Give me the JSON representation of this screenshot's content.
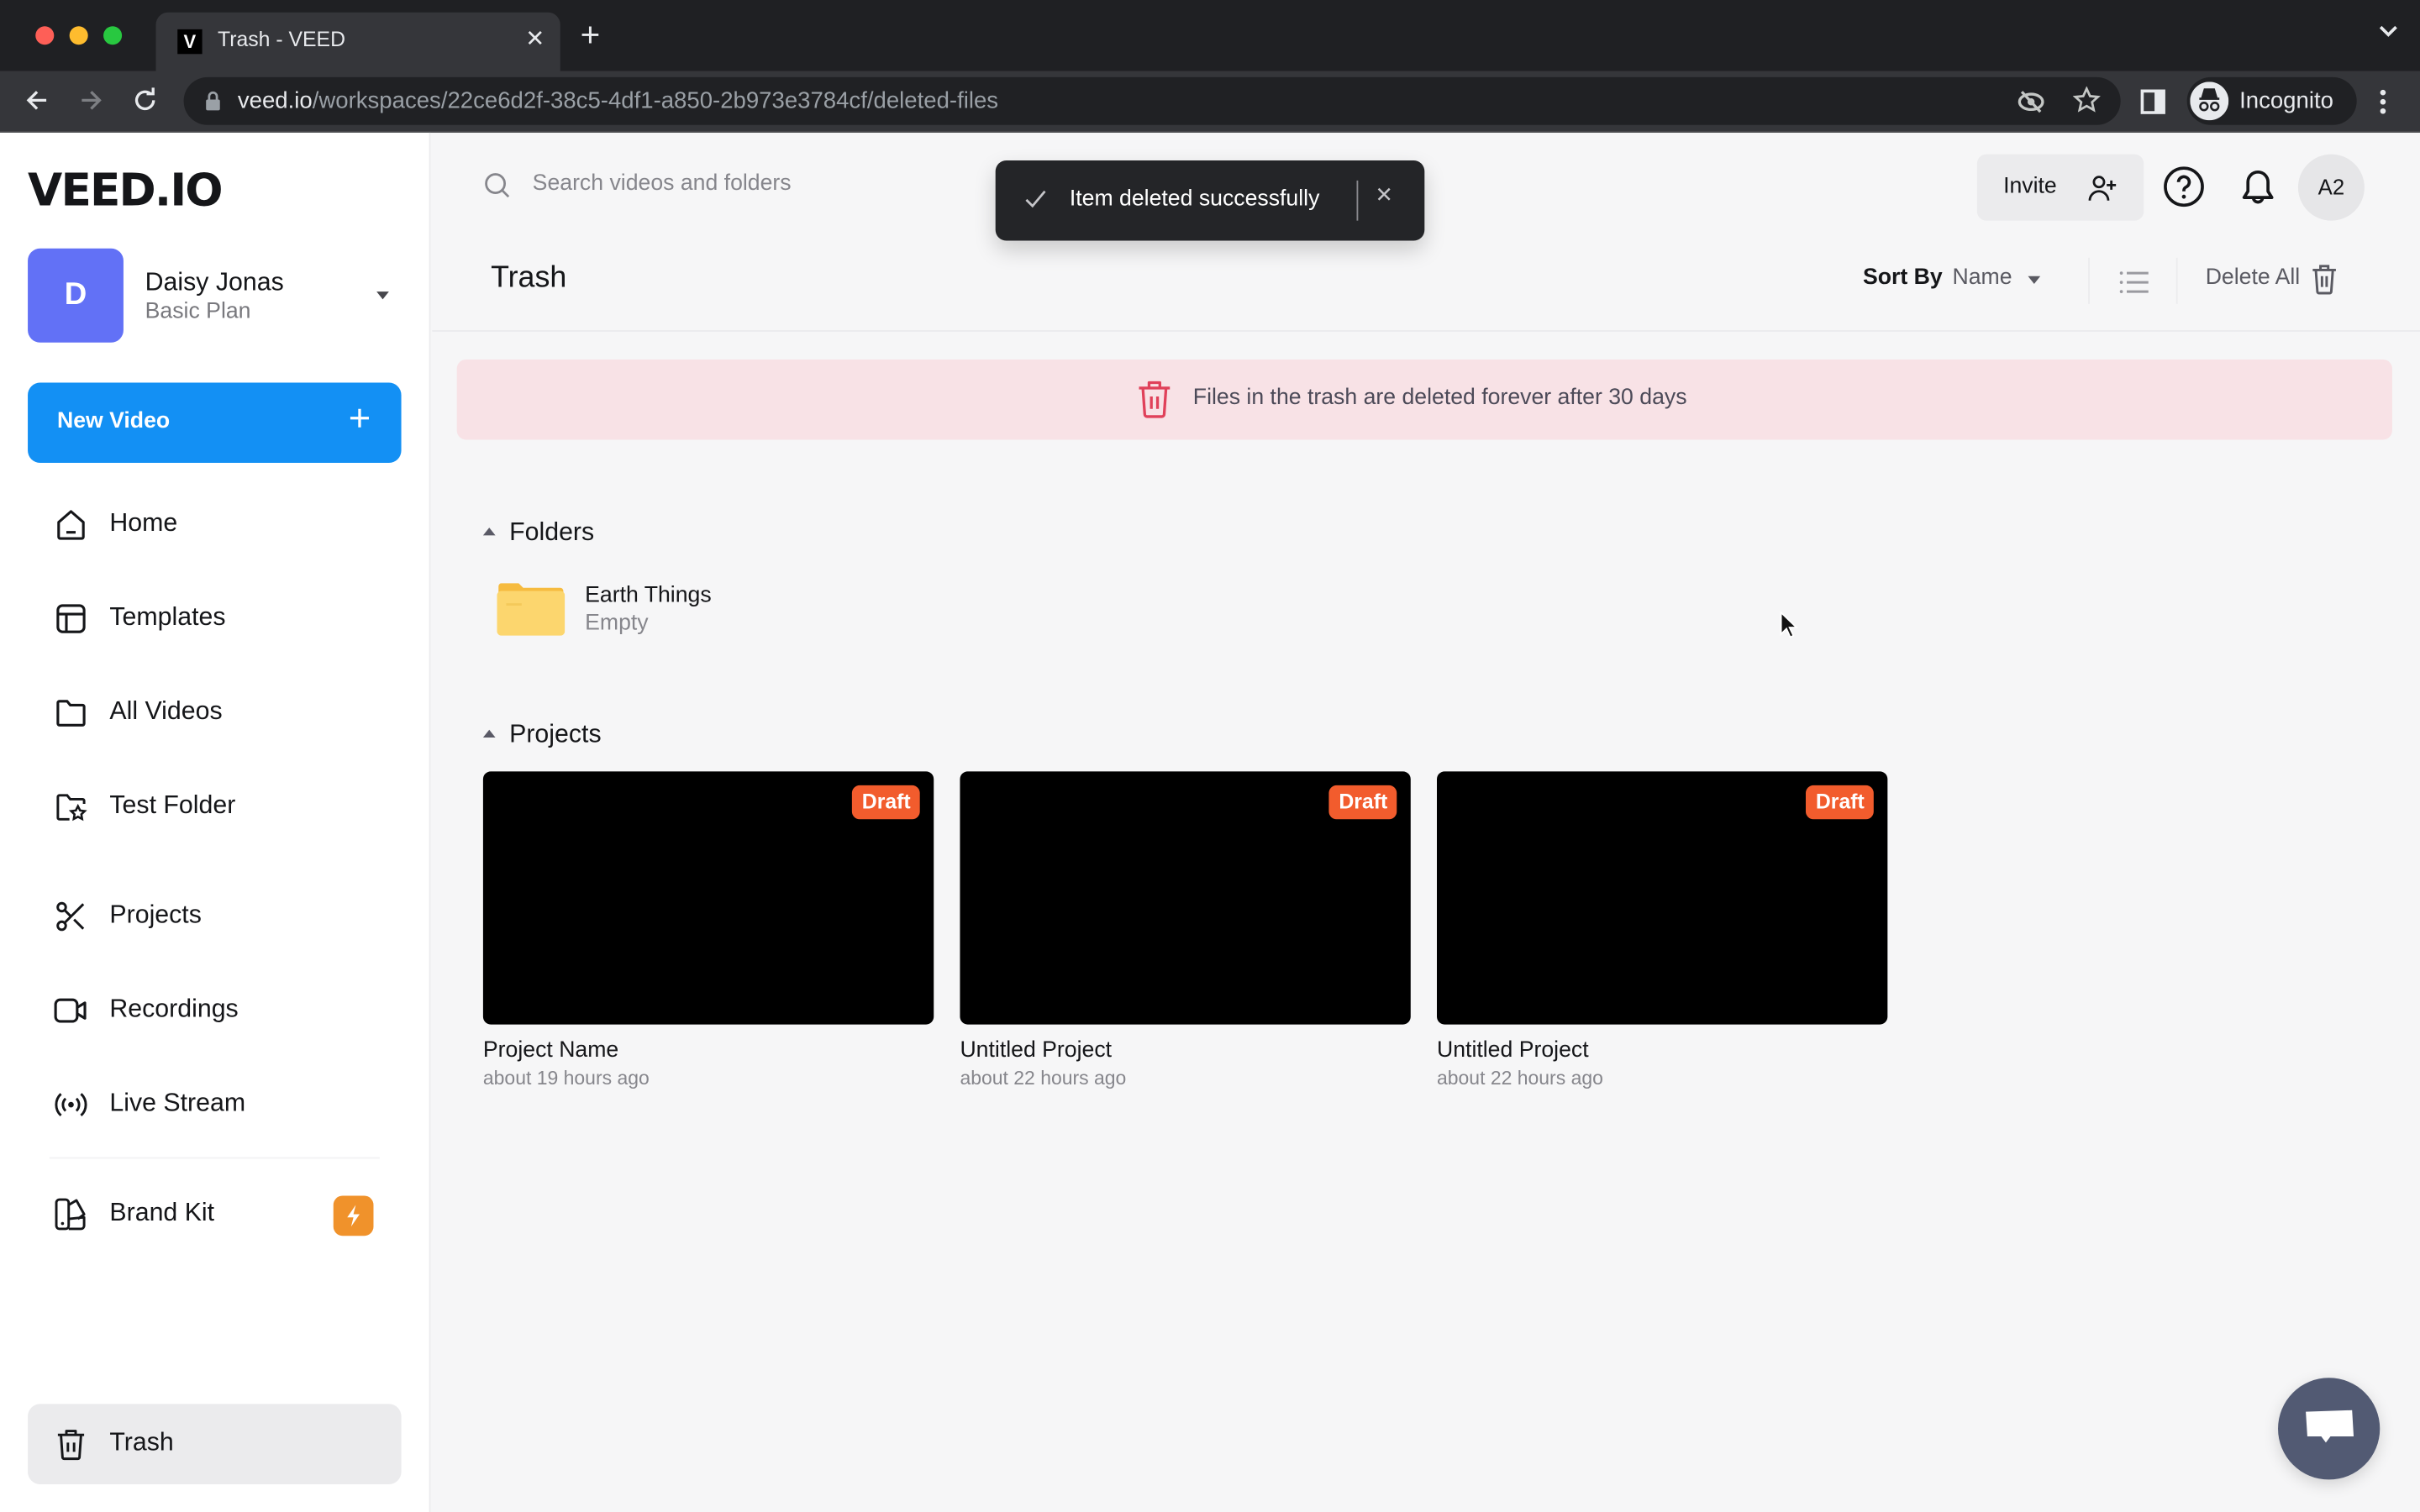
{
  "browser": {
    "tab_title": "Trash - VEED",
    "tab_favicon": "V",
    "url_host": "veed.io",
    "url_path": "/workspaces/22ce6d2f-38c5-4df1-a850-2b973e3784cf/deleted-files",
    "profile_label": "Incognito"
  },
  "sidebar": {
    "logo": "VEED.IO",
    "workspace": {
      "initial": "D",
      "name": "Daisy Jonas",
      "plan": "Basic Plan",
      "avatar_color": "#6271f6"
    },
    "new_video_label": "New Video",
    "items": [
      {
        "label": "Home",
        "icon": "home-icon"
      },
      {
        "label": "Templates",
        "icon": "templates-icon"
      },
      {
        "label": "All Videos",
        "icon": "folder-icon"
      },
      {
        "label": "Test Folder",
        "icon": "folder-star-icon"
      },
      {
        "label": "Projects",
        "icon": "scissors-icon"
      },
      {
        "label": "Recordings",
        "icon": "video-camera-icon"
      },
      {
        "label": "Live Stream",
        "icon": "broadcast-icon"
      },
      {
        "label": "Brand Kit",
        "icon": "brand-kit-icon",
        "badge": "lightning-icon"
      },
      {
        "label": "Trash",
        "icon": "trash-icon",
        "active": true
      }
    ]
  },
  "header": {
    "search_placeholder": "Search videos and folders",
    "search_value": "",
    "invite_label": "Invite",
    "account_initials": "A2"
  },
  "toast": {
    "message": "Item deleted successfully"
  },
  "page": {
    "title": "Trash",
    "sort_by_label": "Sort By",
    "sort_by_value": "Name",
    "delete_all_label": "Delete All",
    "banner_text": "Files in the trash are deleted forever after 30 days"
  },
  "folders": {
    "heading": "Folders",
    "items": [
      {
        "name": "Earth Things",
        "meta": "Empty"
      }
    ]
  },
  "projects": {
    "heading": "Projects",
    "items": [
      {
        "title": "Project Name",
        "meta": "about 19 hours ago",
        "badge": "Draft"
      },
      {
        "title": "Untitled Project",
        "meta": "about 22 hours ago",
        "badge": "Draft"
      },
      {
        "title": "Untitled Project",
        "meta": "about 22 hours ago",
        "badge": "Draft"
      }
    ]
  },
  "colors": {
    "accent": "#1390f4",
    "draft_badge": "#f25c2d",
    "banner_bg": "#f8e2e6",
    "banner_icon": "#e0415a",
    "pro_badge": "#f0922b"
  }
}
